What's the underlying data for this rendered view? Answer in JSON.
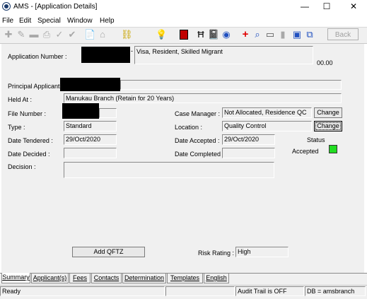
{
  "window": {
    "title": "AMS - [Application Details]",
    "minimize_glyph": "—",
    "maximize_glyph": "☐",
    "close_glyph": "✕"
  },
  "menu": [
    "File",
    "Edit",
    "Special",
    "Window",
    "Help"
  ],
  "toolbar": {
    "back_label": "Back",
    "icons": [
      "plus-icon",
      "pencil-icon",
      "minus-icon",
      "printer-icon",
      "check-icon",
      "double-check-icon",
      "document-icon",
      "house-icon",
      "link-icon",
      "lightbulb-icon",
      "red-box-icon",
      "binoculars-icon",
      "notebook-icon",
      "globe-icon",
      "red-cross-icon",
      "magnifier-icon",
      "card-icon",
      "gray-box-icon",
      "window-icon",
      "copy-icon"
    ]
  },
  "form": {
    "application_number_label": "Application Number :",
    "application_type": "Visa, Resident, Skilled Migrant",
    "time_value": "00.00",
    "principal_applicant_label": "Principal Applicant :",
    "held_at_label": "Held At :",
    "held_at_value": "Manukau Branch (Retain for 20 Years)",
    "file_number_label": "File Number :",
    "type_label": "Type :",
    "type_value": "Standard",
    "date_tendered_label": "Date Tendered :",
    "date_tendered_value": "29/Oct/2020",
    "date_decided_label": "Date Decided :",
    "date_decided_value": "",
    "decision_label": "Decision :",
    "decision_value": "",
    "case_manager_label": "Case Manager :",
    "case_manager_value": "Not Allocated, Residence QC",
    "location_label": "Location :",
    "location_value": "Quality Control",
    "date_accepted_label": "Date Accepted :",
    "date_accepted_value": "29/Oct/2020",
    "date_completed_label": "Date Completed :",
    "date_completed_value": "",
    "change_label": "Change",
    "status_label": "Status",
    "status_value": "Accepted",
    "status_color": "#22dd22",
    "add_qftz_label": "Add QFTZ",
    "risk_rating_label": "Risk Rating :",
    "risk_rating_value": "High"
  },
  "tabs": [
    "Summary",
    "Applicant(s)",
    "Fees",
    "Contacts",
    "Determination",
    "Templates",
    "English"
  ],
  "statusbar": {
    "ready": "Ready",
    "audit_trail": "Audit Trail is OFF",
    "db": "DB = amsbranch"
  }
}
